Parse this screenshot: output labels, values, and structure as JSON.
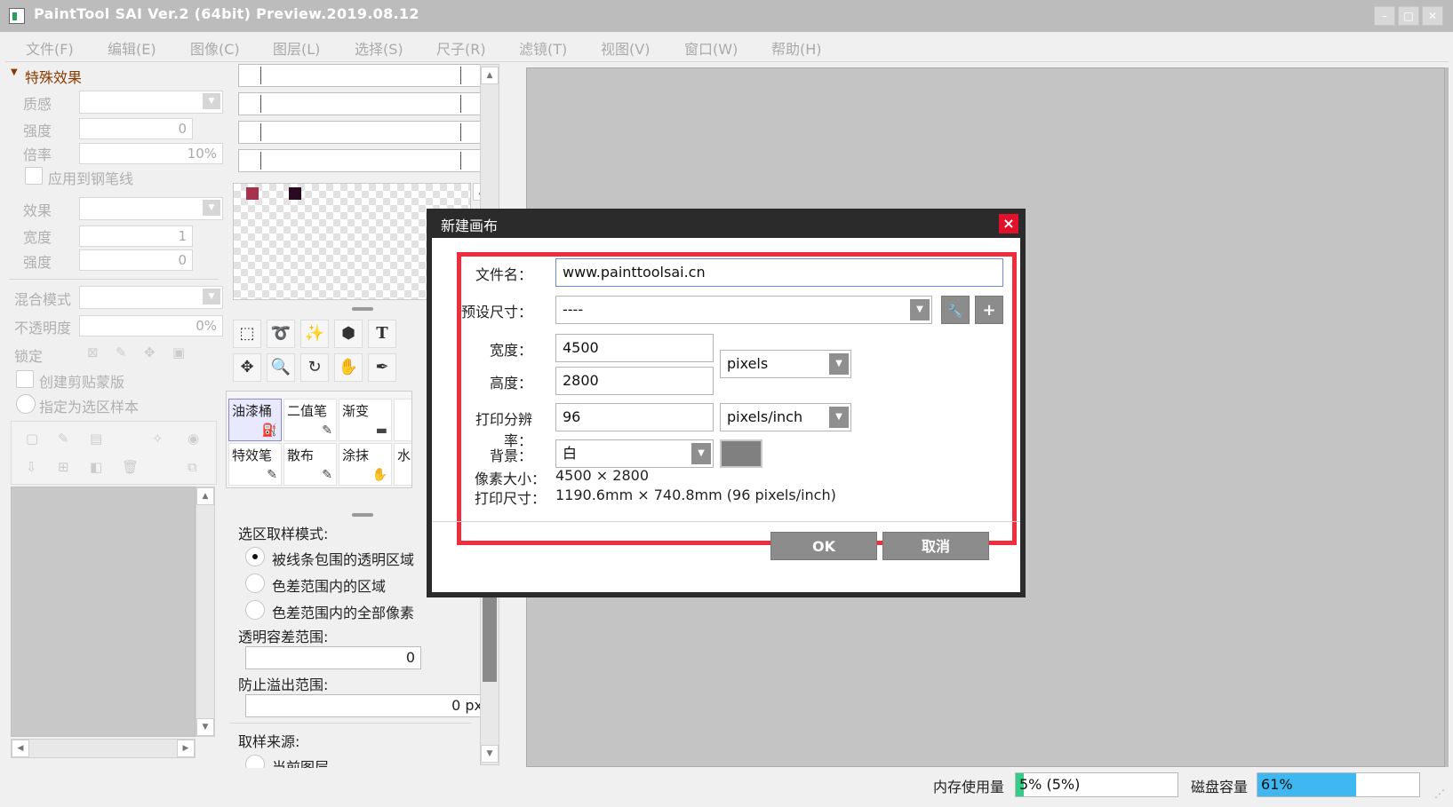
{
  "window": {
    "title": "PaintTool SAI Ver.2 (64bit) Preview.2019.08.12",
    "min": "–",
    "max": "□",
    "close": "✕"
  },
  "menu": [
    "文件(F)",
    "编辑(E)",
    "图像(C)",
    "图层(L)",
    "选择(S)",
    "尺子(R)",
    "滤镜(T)",
    "视图(V)",
    "窗口(W)",
    "帮助(H)"
  ],
  "left": {
    "section": "特殊效果",
    "texture_label": "质感",
    "strength_label": "强度",
    "strength_value": "0",
    "rate_label": "倍率",
    "rate_value": "10%",
    "apply_pen": "应用到钢笔线",
    "effect_label": "效果",
    "width_label": "宽度",
    "width_value": "1",
    "strength2_label": "强度",
    "strength2_value": "0",
    "blend_label": "混合模式",
    "opacity_label": "不透明度",
    "opacity_value": "0%",
    "lock_label": "锁定",
    "clip_label": "创建剪贴蒙版",
    "sample_label": "指定为选区样本"
  },
  "tools": {
    "text_tool": "T"
  },
  "brushes": [
    {
      "label": "油漆桶",
      "icon": "bucket-icon",
      "glyph": "⛽"
    },
    {
      "label": "二值笔",
      "icon": "pen-icon",
      "glyph": "✎"
    },
    {
      "label": "渐变",
      "icon": "gradient-icon",
      "glyph": "▬"
    },
    {
      "label": "特效笔",
      "icon": "pen-icon",
      "glyph": "✎"
    },
    {
      "label": "散布",
      "icon": "pen-icon",
      "glyph": "✎"
    },
    {
      "label": "涂抹",
      "icon": "smudge-icon",
      "glyph": "✋"
    },
    {
      "label": "水",
      "icon": "water-icon",
      "glyph": ""
    }
  ],
  "selection": {
    "mode_label": "选区取样模式:",
    "opt1": "被线条包围的透明区域",
    "opt2": "色差范围内的区域",
    "opt3": "色差范围内的全部像素",
    "tolerance_label": "透明容差范围:",
    "tolerance_value": "0",
    "overflow_label": "防止溢出范围:",
    "overflow_value": "0 px",
    "source_label": "取样来源:",
    "source_opt": "当前图层"
  },
  "dialog": {
    "title": "新建画布",
    "close": "×",
    "filename_label": "文件名：",
    "filename_value": "www.painttoolsai.cn",
    "preset_label": "预设尺寸：",
    "preset_value": "----",
    "width_label": "宽度：",
    "width_value": "4500",
    "height_label": "高度：",
    "height_value": "2800",
    "unit_value": "pixels",
    "dpi_label": "打印分辨率：",
    "dpi_value": "96",
    "dpi_unit": "pixels/inch",
    "bg_label": "背景：",
    "bg_value": "白",
    "bg_swatch_color": "#808080",
    "pixel_size_label": "像素大小：",
    "pixel_size_value": "4500 × 2800",
    "print_size_label": "打印尺寸：",
    "print_size_value": "1190.6mm × 740.8mm (96 pixels/inch)",
    "ok": "OK",
    "cancel": "取消",
    "wrench": "🔧",
    "plus": "+"
  },
  "status": {
    "memory_label": "内存使用量",
    "memory_value": "5% (5%)",
    "memory_fraction": 0.05,
    "disk_label": "磁盘容量",
    "disk_value": "61%",
    "disk_fraction": 0.61,
    "memory_color": "#33cc88",
    "disk_color": "#3fb7f0"
  },
  "colors": {
    "swatch1": "#a8324e",
    "swatch2": "#2a0a22",
    "highlight": "#f02d3c",
    "dialog_header": "#2b2b2b"
  }
}
